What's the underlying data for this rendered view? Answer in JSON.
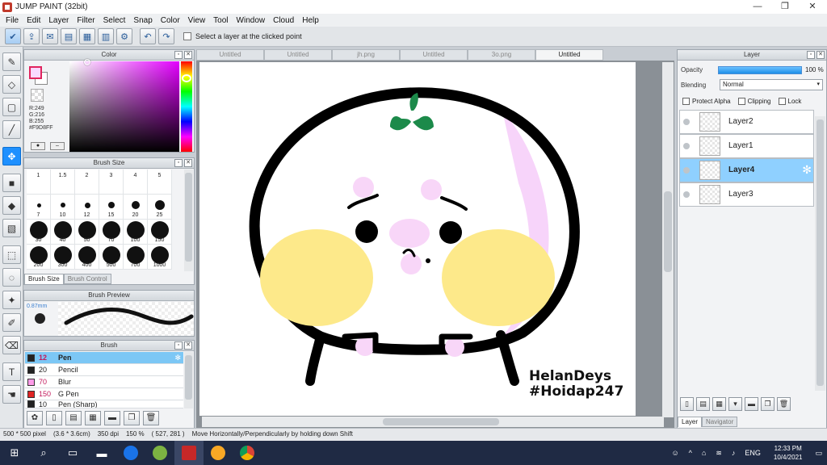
{
  "window": {
    "title": "JUMP PAINT (32bit)",
    "minimize": "—",
    "maximize": "❐",
    "close": "✕"
  },
  "menu": [
    "File",
    "Edit",
    "Layer",
    "Filter",
    "Select",
    "Snap",
    "Color",
    "View",
    "Tool",
    "Window",
    "Cloud",
    "Help"
  ],
  "toolbar": {
    "select_layer_label": "Select a layer at the clicked point"
  },
  "color_panel": {
    "title": "Color",
    "r": "R:249",
    "g": "G:216",
    "b": "B:255",
    "hex": "#F9D8FF",
    "fg_color": "#f9d8ff"
  },
  "brush_size": {
    "title": "Brush Size",
    "sizes": [
      "1",
      "1.5",
      "2",
      "3",
      "4",
      "5",
      "7",
      "10",
      "12",
      "15",
      "20",
      "25",
      "30",
      "40",
      "50",
      "70",
      "100",
      "150",
      "200",
      "300",
      "400",
      "500",
      "700",
      "1000"
    ],
    "tabs": [
      "Brush Size",
      "Brush Control"
    ]
  },
  "brush_preview": {
    "title": "Brush Preview",
    "size": "0.87mm"
  },
  "brush_list": {
    "title": "Brush",
    "items": [
      {
        "size": "12",
        "name": "Pen",
        "color": "#222222"
      },
      {
        "size": "20",
        "name": "Pencil",
        "color": "#222222"
      },
      {
        "size": "70",
        "name": "Blur",
        "color": "#ff9be8"
      },
      {
        "size": "150",
        "name": "G Pen",
        "color": "#e02424"
      },
      {
        "size": "10",
        "name": "Pen (Sharp)",
        "color": "#222222"
      }
    ]
  },
  "doc_tabs": [
    "Untitled",
    "Untitled",
    "jh.png",
    "Untitled",
    "3o.png",
    "Untitled"
  ],
  "canvas": {
    "signature_line1": "HelanDeys",
    "signature_line2": "#Hoidap247"
  },
  "layer_panel": {
    "title": "Layer",
    "opacity_label": "Opacity",
    "opacity_value": "100 %",
    "opacity_fraction": 1.0,
    "blending_label": "Blending",
    "blending_value": "Normal",
    "protect_alpha": "Protect Alpha",
    "clipping": "Clipping",
    "lock": "Lock",
    "layers": [
      "Layer2",
      "Layer1",
      "Layer4",
      "Layer3"
    ],
    "selected_layer": "Layer4",
    "tabs": [
      "Layer",
      "Navigator"
    ]
  },
  "status": {
    "size": "500 * 500 pixel",
    "cm": "(3.6 * 3.6cm)",
    "dpi": "350 dpi",
    "zoom": "150 %",
    "coords": "( 527, 281 )",
    "hint": "Move Horizontally/Perpendicularly by holding down Shift"
  },
  "taskbar": {
    "lang": "ENG",
    "time": "12:33 PM",
    "date": "10/4/2021"
  }
}
